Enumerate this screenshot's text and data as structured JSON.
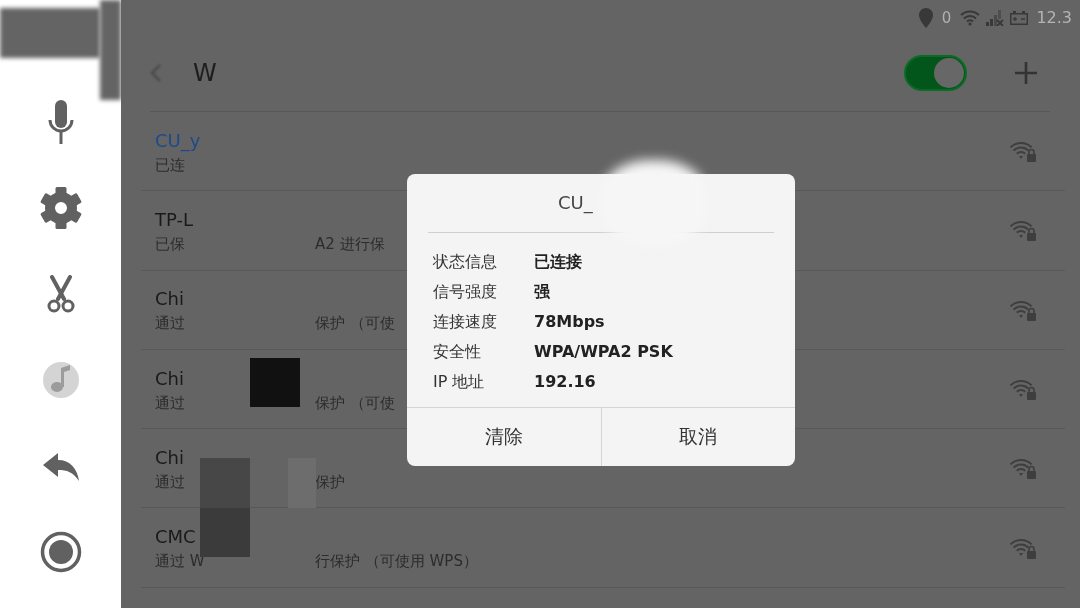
{
  "status_bar": {
    "count": "0",
    "time": "12.3"
  },
  "header": {
    "title": "W",
    "wlan_switch": {
      "on": true
    }
  },
  "networks": [
    {
      "name": "CU_y",
      "subtitle": [
        "已连"
      ],
      "connected": true
    },
    {
      "name": "TP-L",
      "subtitle": [
        "已保",
        "A2 进行保"
      ],
      "connected": false
    },
    {
      "name": "Chi",
      "subtitle": [
        "通过",
        "保护 （可使"
      ],
      "connected": false
    },
    {
      "name": "Chi",
      "subtitle": [
        "通过",
        "保护 （可使"
      ],
      "connected": false
    },
    {
      "name": "Chi",
      "subtitle": [
        "通过",
        "保护"
      ],
      "connected": false
    },
    {
      "name": "CMC",
      "subtitle": [
        "通过 W",
        "行保护 （可使用 WPS）"
      ],
      "connected": false
    }
  ],
  "dialog": {
    "title": "CU_",
    "rows": [
      {
        "label": "状态信息",
        "value": "已连接"
      },
      {
        "label": "信号强度",
        "value": "强"
      },
      {
        "label": "连接速度",
        "value": "78Mbps"
      },
      {
        "label": "安全性",
        "value": "WPA/WPA2 PSK"
      },
      {
        "label": "IP 地址",
        "value": "192.16"
      }
    ],
    "buttons": [
      "清除",
      "取消"
    ]
  }
}
